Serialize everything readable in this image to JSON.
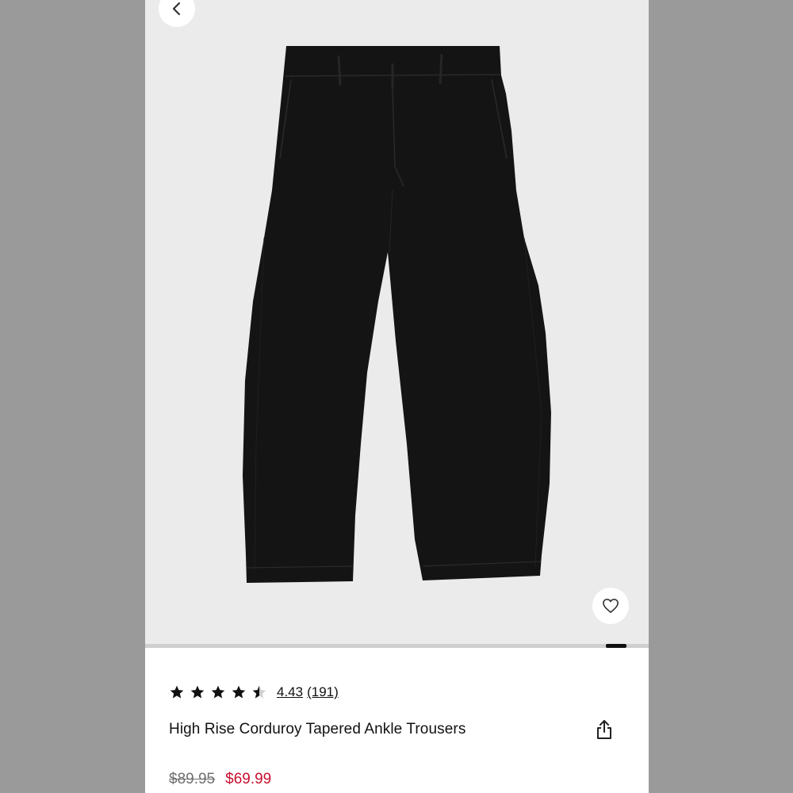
{
  "navigation": {
    "back_icon": "chevron-left-icon"
  },
  "product": {
    "image_alt": "Black corduroy tapered ankle trousers",
    "favorite_icon": "heart-icon",
    "gallery": {
      "current_index": 5,
      "total_images": 5
    },
    "rating": {
      "stars": 4.43,
      "value_label": "4.43",
      "count_label": "(191)"
    },
    "title": "High Rise Corduroy Tapered Ankle Trousers",
    "share_icon": "share-icon",
    "price": {
      "original": "$89.95",
      "sale": "$69.99"
    }
  },
  "colors": {
    "sale_price": "#c8102e",
    "background": "#ebebeb",
    "garment": "#141414"
  }
}
